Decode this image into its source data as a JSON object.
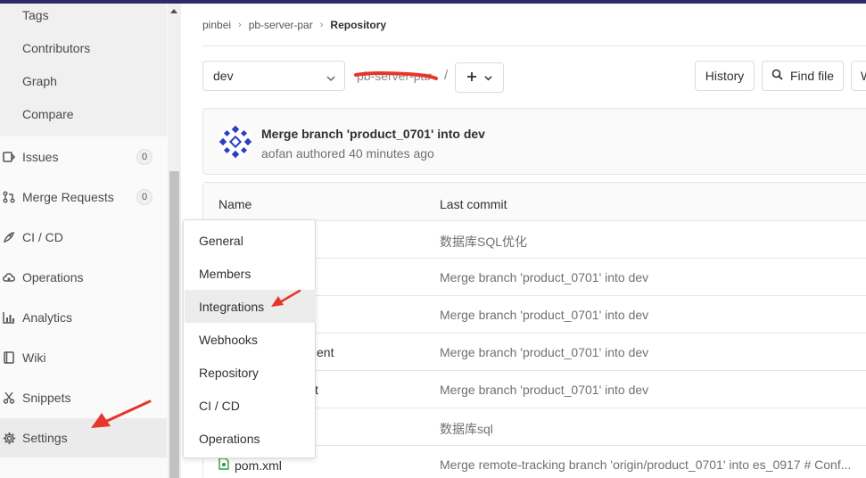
{
  "sidebar": {
    "repo_subitems": [
      "Tags",
      "Contributors",
      "Graph",
      "Compare"
    ],
    "items": [
      {
        "label": "Issues",
        "icon": "issues-icon",
        "count": "0"
      },
      {
        "label": "Merge Requests",
        "icon": "merge-request-icon",
        "count": "0"
      },
      {
        "label": "CI / CD",
        "icon": "rocket-icon"
      },
      {
        "label": "Operations",
        "icon": "cloud-gear-icon"
      },
      {
        "label": "Analytics",
        "icon": "chart-icon"
      },
      {
        "label": "Wiki",
        "icon": "book-icon"
      },
      {
        "label": "Snippets",
        "icon": "scissors-icon"
      },
      {
        "label": "Settings",
        "icon": "gear-icon"
      }
    ]
  },
  "settings_flyout": {
    "items": [
      "General",
      "Members",
      "Integrations",
      "Webhooks",
      "Repository",
      "CI / CD",
      "Operations"
    ],
    "hovered": "Integrations"
  },
  "breadcrumb": [
    "pinbei",
    "pb-server-par",
    "Repository"
  ],
  "toolbar": {
    "branch": "dev",
    "path_fragment": "pb-server-par",
    "path_separator": "/",
    "history_label": "History",
    "find_file_label": "Find file",
    "web_ide_partial": "W"
  },
  "last_commit": {
    "title": "Merge branch 'product_0701' into dev",
    "meta": "aofan authored 40 minutes ago"
  },
  "file_table": {
    "headers": {
      "name": "Name",
      "last_commit": "Last commit"
    },
    "rows": [
      {
        "name": "",
        "commit": "数据库SQL优化"
      },
      {
        "name": "",
        "commit": "Merge branch 'product_0701' into dev"
      },
      {
        "name": "",
        "commit": "Merge branch 'product_0701' into dev"
      },
      {
        "name": "ent",
        "commit": "Merge branch 'product_0701' into dev"
      },
      {
        "name": "t",
        "commit": "Merge branch 'product_0701' into dev"
      },
      {
        "name": "",
        "commit": "数据库sql"
      },
      {
        "name": "pom.xml",
        "commit": "Merge remote-tracking branch 'origin/product_0701' into es_0917 # Conf..."
      }
    ]
  },
  "colors": {
    "topbar": "#2f2a6b",
    "annotation_arrow": "#e8352b",
    "redaction": "#e8352b",
    "avatar": "#2b3fc4"
  }
}
